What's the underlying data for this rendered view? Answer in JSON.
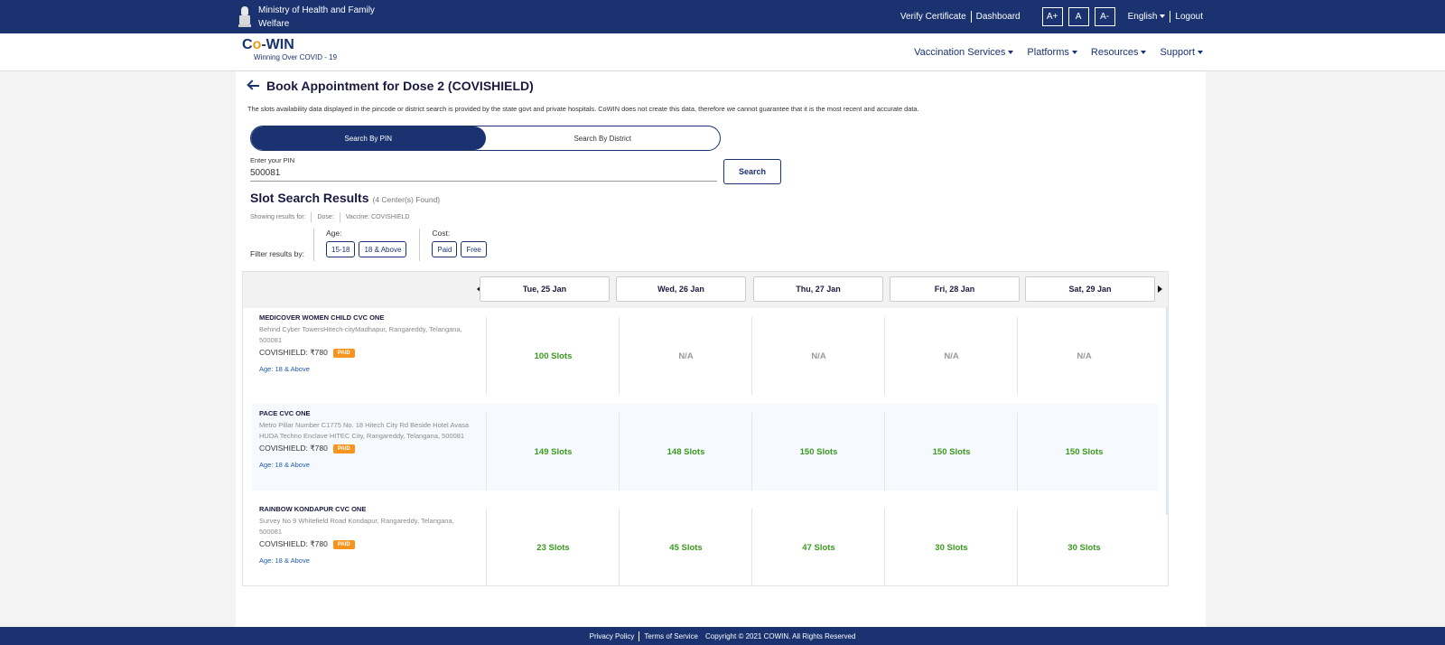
{
  "topbar": {
    "ministry": "Ministry of Health and Family Welfare",
    "links": [
      "Verify Certificate",
      "Dashboard"
    ],
    "font_sizes": [
      "A+",
      "A",
      "A-"
    ],
    "language": "English",
    "logout": "Logout"
  },
  "header": {
    "logo_pre": "C",
    "logo_plus": "o",
    "logo_post": "-WIN",
    "tagline": "Winning Over COVID - 19",
    "nav": [
      "Vaccination Services",
      "Platforms",
      "Resources",
      "Support"
    ]
  },
  "page": {
    "title": "Book Appointment for Dose 2 (COVISHIELD)",
    "disclaimer": "The slots availability data displayed in the pincode or district search is provided by the state govt and private hospitals. CoWIN does not create this data, therefore we cannot guarantee that it is the most recent and accurate data.",
    "toggle": [
      "Search By PIN",
      "Search By District"
    ],
    "pin_label": "Enter your PIN",
    "pin_value": "500081",
    "search_label": "Search",
    "results_title": "Slot Search Results",
    "results_count": "(4 Center(s) Found)",
    "showing": [
      "Showing results for:",
      "Dose:",
      "Vaccine: COVISHIELD"
    ],
    "filter_label": "Filter results by:",
    "age_label": "Age:",
    "age_options": [
      "15-18",
      "18 & Above"
    ],
    "cost_label": "Cost:",
    "cost_options": [
      "Paid",
      "Free"
    ]
  },
  "dates": [
    "Tue, 25 Jan",
    "Wed, 26 Jan",
    "Thu, 27 Jan",
    "Fri, 28 Jan",
    "Sat, 29 Jan"
  ],
  "centers": [
    {
      "name": "MEDICOVER WOMEN CHILD CVC ONE",
      "address": "Behind Cyber TowersHitech-cityMadhapur, Rangareddy, Telangana, 500081",
      "vaccine": "COVISHIELD: ₹780",
      "badge": "PAID",
      "age": "Age: 18 & Above",
      "slots": [
        "100 Slots",
        "N/A",
        "N/A",
        "N/A",
        "N/A"
      ]
    },
    {
      "name": "PACE CVC ONE",
      "address": "Metro Pillar Number C1775 No. 18 Hitech City Rd Beside Hotel Avasa HUDA Techno Enclave HITEC City, Rangareddy, Telangana, 500081",
      "vaccine": "COVISHIELD: ₹780",
      "badge": "PAID",
      "age": "Age: 18 & Above",
      "slots": [
        "149 Slots",
        "148 Slots",
        "150 Slots",
        "150 Slots",
        "150 Slots"
      ]
    },
    {
      "name": "RAINBOW KONDAPUR CVC ONE",
      "address": "Survey No 9 Whitefield Road Kondapur, Rangareddy, Telangana, 500081",
      "vaccine": "COVISHIELD: ₹780",
      "badge": "PAID",
      "age": "Age: 18 & Above",
      "slots": [
        "23 Slots",
        "45 Slots",
        "47 Slots",
        "30 Slots",
        "30 Slots"
      ]
    }
  ],
  "footer": {
    "links": [
      "Privacy Policy",
      "Terms of Service"
    ],
    "copyright": "Copyright © 2021 COWIN. All Rights Reserved"
  },
  "colors": {
    "primary": "#1a3270",
    "slots_available": "#3a9a1e",
    "paid_badge": "#f7941d"
  }
}
